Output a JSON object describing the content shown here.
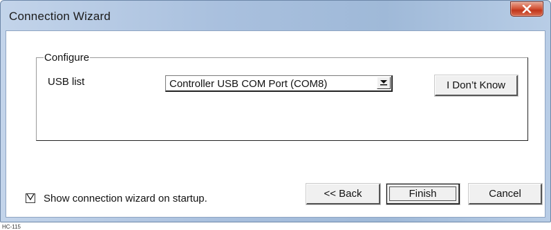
{
  "window": {
    "title": "Connection Wizard",
    "close_glyph": "X"
  },
  "configure_group": {
    "label": "Configure",
    "usb_label": "USB list",
    "usb_selected": "Controller USB COM Port (COM8)",
    "dont_know_label": "I Don’t Know"
  },
  "startup": {
    "checked": true,
    "label": "Show connection wizard on startup."
  },
  "buttons": {
    "back_label": "<< Back",
    "finish_label": "Finish",
    "cancel_label": "Cancel"
  },
  "footer": {
    "code": "HC-115"
  },
  "colors": {
    "titlebar_blue": "#a9c0de",
    "close_red": "#c1371c",
    "button_face": "#f0f0f0"
  },
  "icons": [
    "close-icon",
    "dropdown-arrow-icon",
    "checkmark-icon"
  ]
}
